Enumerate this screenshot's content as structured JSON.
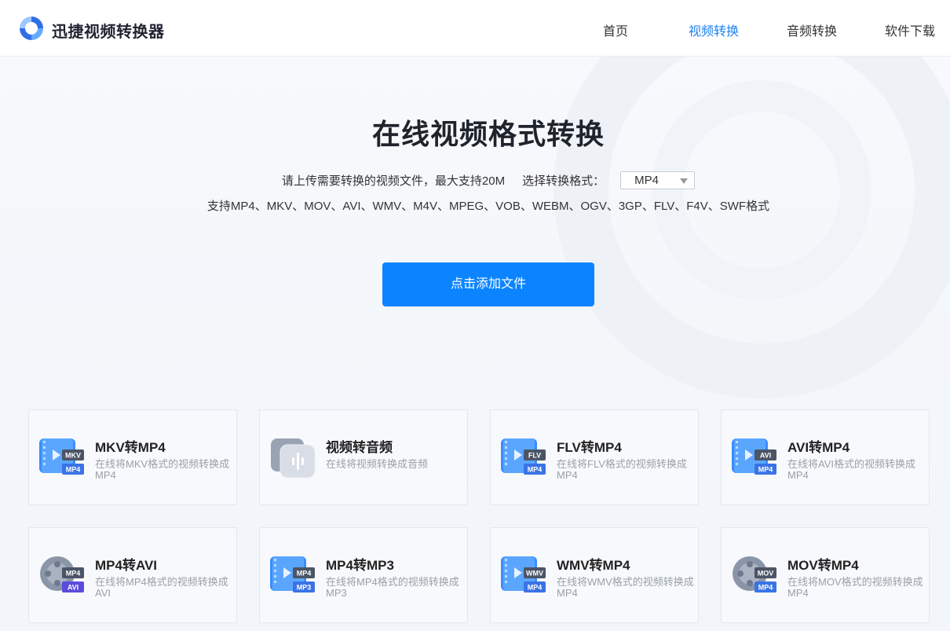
{
  "header": {
    "brand": "迅捷视频转换器",
    "nav": [
      {
        "label": "首页",
        "active": false
      },
      {
        "label": "视频转换",
        "active": true
      },
      {
        "label": "音频转换",
        "active": false
      },
      {
        "label": "软件下载",
        "active": false
      }
    ]
  },
  "hero": {
    "title": "在线视频格式转换",
    "upload_hint": "请上传需要转换的视频文件，最大支持20M",
    "format_label": "选择转换格式：",
    "format_selected": "MP4",
    "supported_formats": "支持MP4、MKV、MOV、AVI、WMV、M4V、MPEG、VOB、WEBM、OGV、3GP、FLV、F4V、SWF格式",
    "add_button": "点击添加文件"
  },
  "cards": [
    {
      "title": "MKV转MP4",
      "desc": "在线将MKV格式的视频转换成MP4",
      "icon": "video-file-icon",
      "tag_top": "MKV",
      "tag_bottom": "MP4"
    },
    {
      "title": "视频转音频",
      "desc": "在线将视频转换成音频",
      "icon": "audio-wave-icon",
      "tag_top": "",
      "tag_bottom": ""
    },
    {
      "title": "FLV转MP4",
      "desc": "在线将FLV格式的视频转换成MP4",
      "icon": "video-file-icon",
      "tag_top": "FLV",
      "tag_bottom": "MP4"
    },
    {
      "title": "AVI转MP4",
      "desc": "在线将AVI格式的视频转换成MP4",
      "icon": "video-file-icon",
      "tag_top": "AVI",
      "tag_bottom": "MP4"
    },
    {
      "title": "MP4转AVI",
      "desc": "在线将MP4格式的视频转换成AVI",
      "icon": "film-reel-icon",
      "tag_top": "MP4",
      "tag_bottom": "AVI"
    },
    {
      "title": "MP4转MP3",
      "desc": "在线将MP4格式的视频转换成MP3",
      "icon": "video-file-icon",
      "tag_top": "MP4",
      "tag_bottom": "MP3"
    },
    {
      "title": "WMV转MP4",
      "desc": "在线将WMV格式的视频转换成MP4",
      "icon": "video-file-icon",
      "tag_top": "WMV",
      "tag_bottom": "MP4"
    },
    {
      "title": "MOV转MP4",
      "desc": "在线将MOV格式的视频转换成MP4",
      "icon": "film-reel-icon",
      "tag_top": "MOV",
      "tag_bottom": "MP4"
    }
  ],
  "colors": {
    "accent": "#0d84ff",
    "nav_active": "#1b82f0",
    "title": "#1e232c",
    "desc": "#9aa0aa"
  }
}
